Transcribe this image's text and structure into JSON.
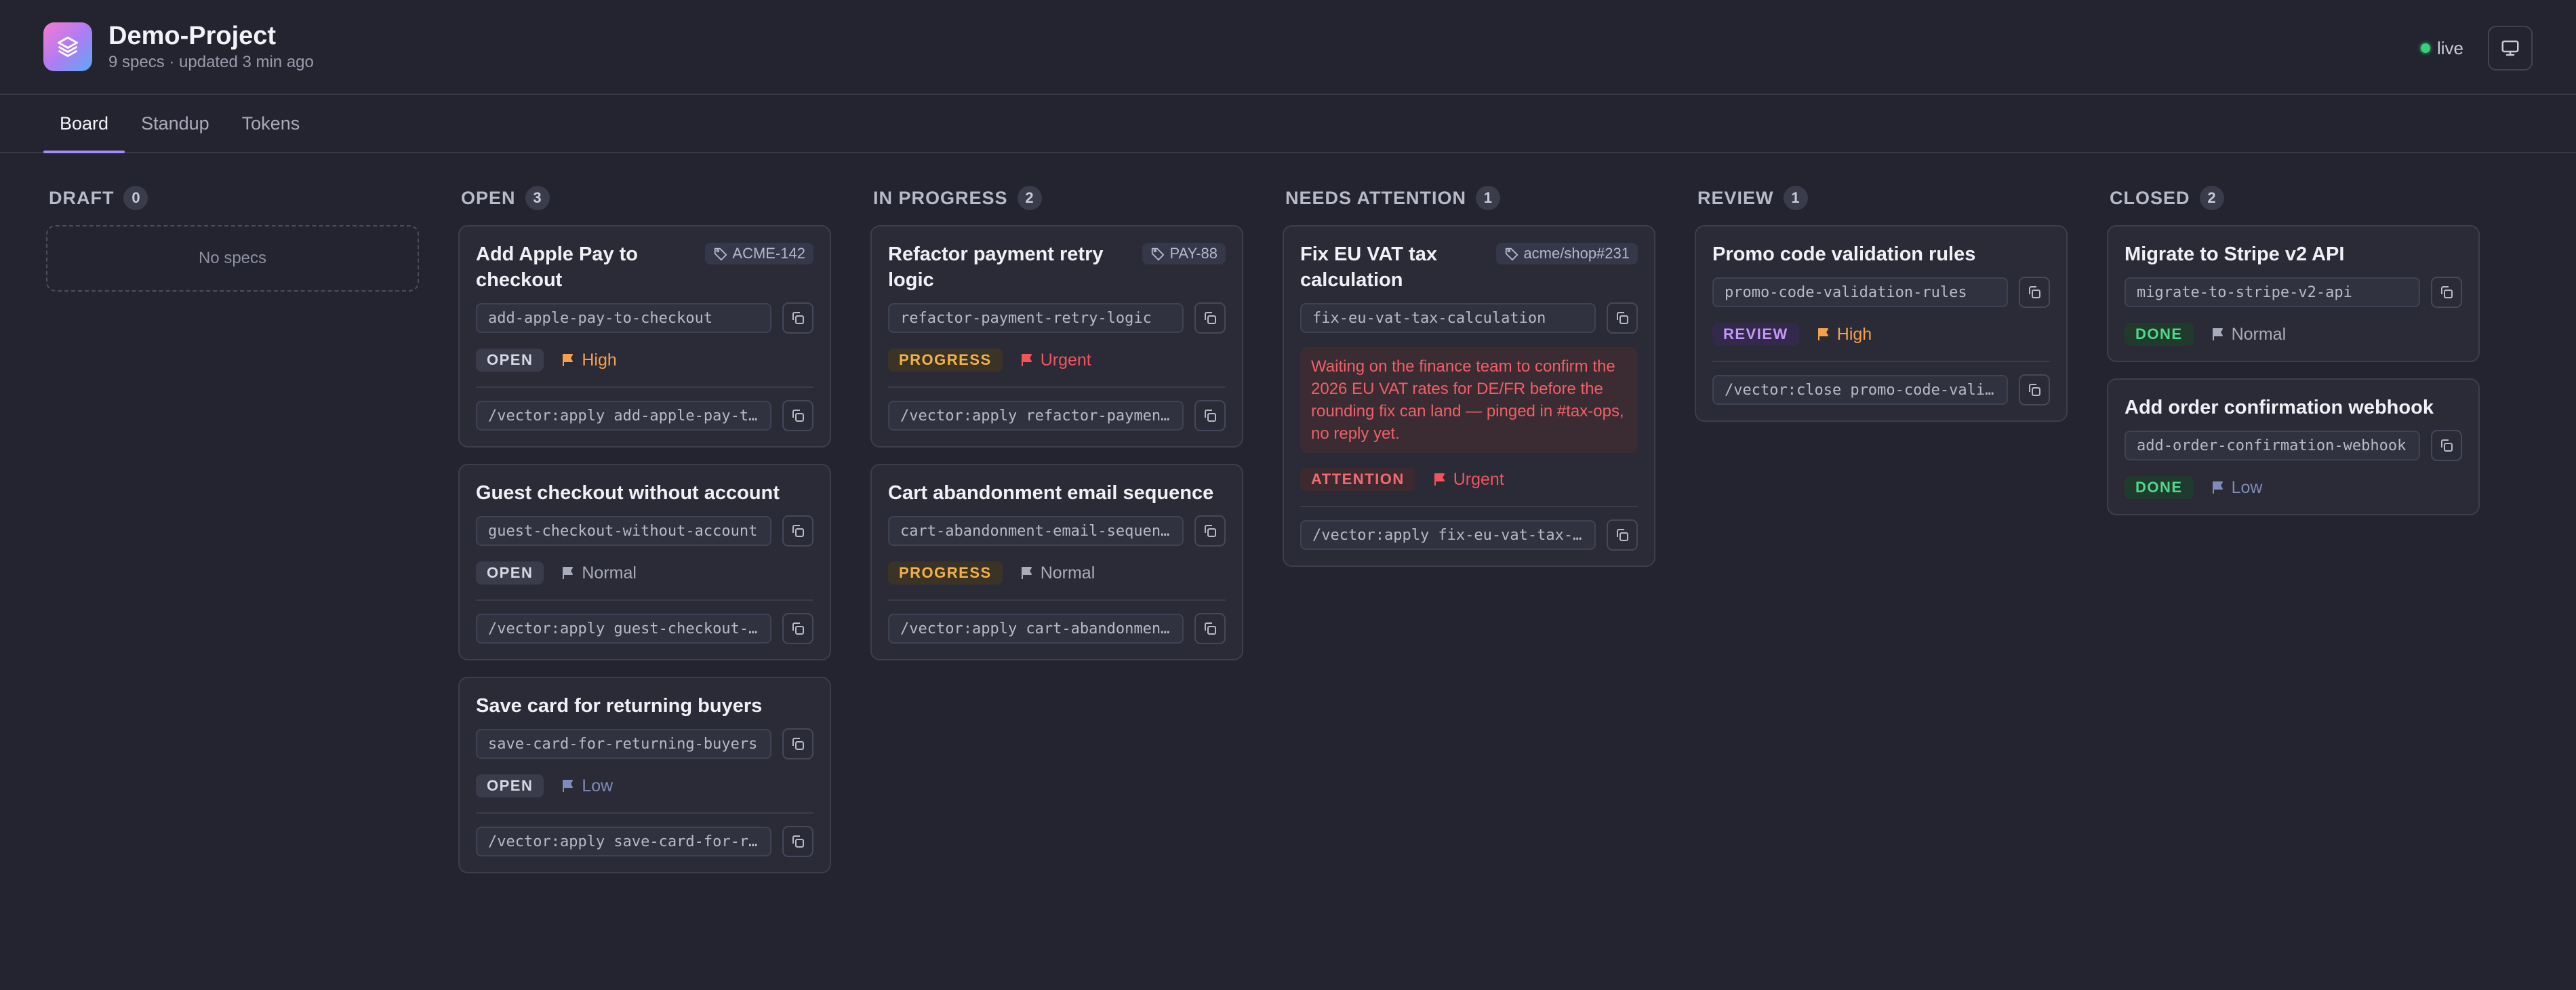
{
  "project": {
    "title": "Demo-Project",
    "subtitle": "9 specs · updated 3 min ago"
  },
  "status": {
    "live_label": "live"
  },
  "icons": {
    "logo": "layers-icon",
    "monitor": "monitor-icon",
    "copy": "copy-icon",
    "tag": "tag-icon",
    "flag": "flag-icon"
  },
  "tabs": [
    {
      "label": "Board",
      "active": true
    },
    {
      "label": "Standup"
    },
    {
      "label": "Tokens"
    }
  ],
  "colors": {
    "accent": "#a78bfa",
    "high": "#f5a04a",
    "urgent": "#f0555e",
    "done": "#4fd98a",
    "review": "#c497fa"
  },
  "columns": [
    {
      "title": "DRAFT",
      "count": "0",
      "empty_label": "No specs",
      "cards": []
    },
    {
      "title": "OPEN",
      "count": "3",
      "cards": [
        {
          "title": "Add Apple Pay to checkout",
          "ticket": "ACME-142",
          "slug": "add-apple-pay-to-checkout",
          "status": "OPEN",
          "priority": "High",
          "command": "/vector:apply add-apple-pay-to-checkout"
        },
        {
          "title": "Guest checkout without account",
          "slug": "guest-checkout-without-account",
          "status": "OPEN",
          "priority": "Normal",
          "command": "/vector:apply guest-checkout-without-account"
        },
        {
          "title": "Save card for returning buyers",
          "slug": "save-card-for-returning-buyers",
          "status": "OPEN",
          "priority": "Low",
          "command": "/vector:apply save-card-for-returning-buyers"
        }
      ]
    },
    {
      "title": "IN PROGRESS",
      "count": "2",
      "cards": [
        {
          "title": "Refactor payment retry logic",
          "ticket": "PAY-88",
          "slug": "refactor-payment-retry-logic",
          "status": "PROGRESS",
          "priority": "Urgent",
          "command": "/vector:apply refactor-payment-retry-logic"
        },
        {
          "title": "Cart abandonment email sequence",
          "slug": "cart-abandonment-email-sequence",
          "status": "PROGRESS",
          "priority": "Normal",
          "command": "/vector:apply cart-abandonment-email-sequence"
        }
      ]
    },
    {
      "title": "NEEDS ATTENTION",
      "count": "1",
      "cards": [
        {
          "title": "Fix EU VAT tax calculation",
          "ticket": "acme/shop#231",
          "slug": "fix-eu-vat-tax-calculation",
          "note": "Waiting on the finance team to confirm the 2026 EU VAT rates for DE/FR before the rounding fix can land — pinged in #tax-ops, no reply yet.",
          "status": "ATTENTION",
          "priority": "Urgent",
          "command": "/vector:apply fix-eu-vat-tax-calculation"
        }
      ]
    },
    {
      "title": "REVIEW",
      "count": "1",
      "cards": [
        {
          "title": "Promo code validation rules",
          "slug": "promo-code-validation-rules",
          "status": "REVIEW",
          "priority": "High",
          "command": "/vector:close promo-code-validation-rules"
        }
      ]
    },
    {
      "title": "CLOSED",
      "count": "2",
      "cards": [
        {
          "title": "Migrate to Stripe v2 API",
          "slug": "migrate-to-stripe-v2-api",
          "status": "DONE",
          "priority": "Normal"
        },
        {
          "title": "Add order confirmation webhook",
          "slug": "add-order-confirmation-webhook",
          "status": "DONE",
          "priority": "Low"
        }
      ]
    }
  ]
}
